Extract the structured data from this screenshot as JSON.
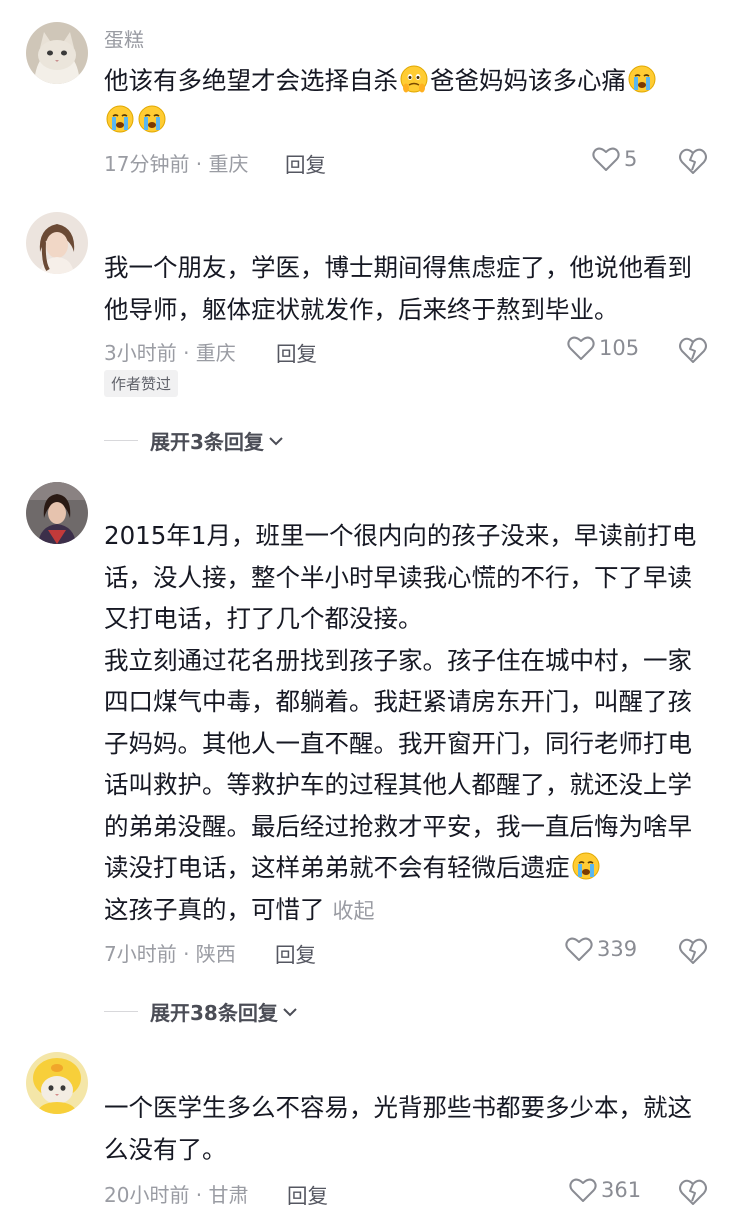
{
  "comments": [
    {
      "username": "蛋糕",
      "text_parts": [
        "他该有多绝望才会选择自杀",
        "爸爸妈妈该多心痛"
      ],
      "emojis": [
        "holding-back-tears-emoji",
        "crying-face-emoji",
        "crying-face-emoji",
        "crying-face-emoji"
      ],
      "meta": "17分钟前 · 重庆",
      "reply_label": "回复",
      "likes": "5"
    },
    {
      "username": "",
      "text": "我一个朋友，学医，博士期间得焦虑症了，他说他看到他导师，躯体症状就发作，后来终于熬到毕业。",
      "meta": "3小时前 · 重庆",
      "reply_label": "回复",
      "likes": "105",
      "badge": "作者赞过",
      "expand_label": "展开3条回复"
    },
    {
      "username": "",
      "paragraphs": [
        "2015年1月，班里一个很内向的孩子没来，早读前打电话，没人接，整个半小时早读我心慌的不行，下了早读又打电话，打了几个都没接。",
        "我立刻通过花名册找到孩子家。孩子住在城中村，一家四口煤气中毒，都躺着。我赶紧请房东开门，叫醒了孩子妈妈。其他人一直不醒。我开窗开门，同行老师打电话叫救护。等救护车的过程其他人都醒了，就还没上学的弟弟没醒。最后经过抢救才平安，我一直后悔为啥早读没打电话，这样弟弟就不会有轻微后遗症",
        "这孩子真的，可惜了"
      ],
      "emojis": [
        "crying-face-emoji"
      ],
      "collapse_label": "收起",
      "meta": "7小时前 · 陕西",
      "reply_label": "回复",
      "likes": "339",
      "expand_label": "展开38条回复"
    },
    {
      "username": "",
      "text": "一个医学生多么不容易，光背那些书都要多少本，就这么没有了。",
      "meta": "20小时前 · 甘肃",
      "reply_label": "回复",
      "likes": "361"
    }
  ],
  "colors": {
    "text": "#161823",
    "meta": "#9a9ca3",
    "reply": "#555761",
    "badge_bg": "#f1f1f2"
  }
}
